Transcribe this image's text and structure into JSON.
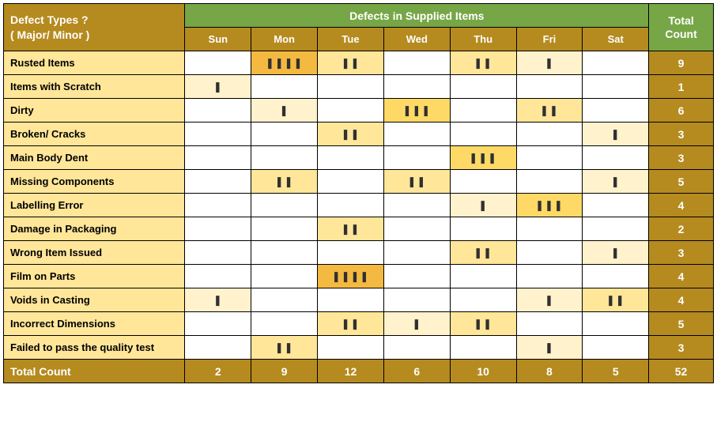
{
  "chart_data": {
    "type": "table",
    "title": "Defects in Supplied Items",
    "corner_label_line1": "Defect Types ?",
    "corner_label_line2": "( Major/ Minor )",
    "total_count_label": "Total Count",
    "footer_label": "Total Count",
    "days": [
      "Sun",
      "Mon",
      "Tue",
      "Wed",
      "Thu",
      "Fri",
      "Sat"
    ],
    "rows": [
      {
        "label": "Rusted Items",
        "cells": [
          0,
          4,
          2,
          0,
          2,
          1,
          0
        ],
        "total": 9
      },
      {
        "label": "Items with Scratch",
        "cells": [
          1,
          0,
          0,
          0,
          0,
          0,
          0
        ],
        "total": 1
      },
      {
        "label": "Dirty",
        "cells": [
          0,
          1,
          0,
          3,
          0,
          2,
          0
        ],
        "total": 6
      },
      {
        "label": "Broken/ Cracks",
        "cells": [
          0,
          0,
          2,
          0,
          0,
          0,
          1
        ],
        "total": 3
      },
      {
        "label": "Main Body Dent",
        "cells": [
          0,
          0,
          0,
          0,
          3,
          0,
          0
        ],
        "total": 3
      },
      {
        "label": "Missing Components",
        "cells": [
          0,
          2,
          0,
          2,
          0,
          0,
          1
        ],
        "total": 5
      },
      {
        "label": "Labelling Error",
        "cells": [
          0,
          0,
          0,
          0,
          1,
          3,
          0
        ],
        "total": 4
      },
      {
        "label": "Damage in Packaging",
        "cells": [
          0,
          0,
          2,
          0,
          0,
          0,
          0
        ],
        "total": 2
      },
      {
        "label": "Wrong Item Issued",
        "cells": [
          0,
          0,
          0,
          0,
          2,
          0,
          1
        ],
        "total": 3
      },
      {
        "label": "Film on Parts",
        "cells": [
          0,
          0,
          4,
          0,
          0,
          0,
          0
        ],
        "total": 4
      },
      {
        "label": "Voids in Casting",
        "cells": [
          1,
          0,
          0,
          0,
          0,
          1,
          2
        ],
        "total": 4
      },
      {
        "label": "Incorrect Dimensions",
        "cells": [
          0,
          0,
          2,
          1,
          2,
          0,
          0
        ],
        "total": 5
      },
      {
        "label": "Failed to  pass the quality test",
        "cells": [
          0,
          2,
          0,
          0,
          0,
          1,
          0
        ],
        "total": 3
      }
    ],
    "column_totals": [
      2,
      9,
      12,
      6,
      10,
      8,
      5
    ],
    "grand_total": 52
  }
}
